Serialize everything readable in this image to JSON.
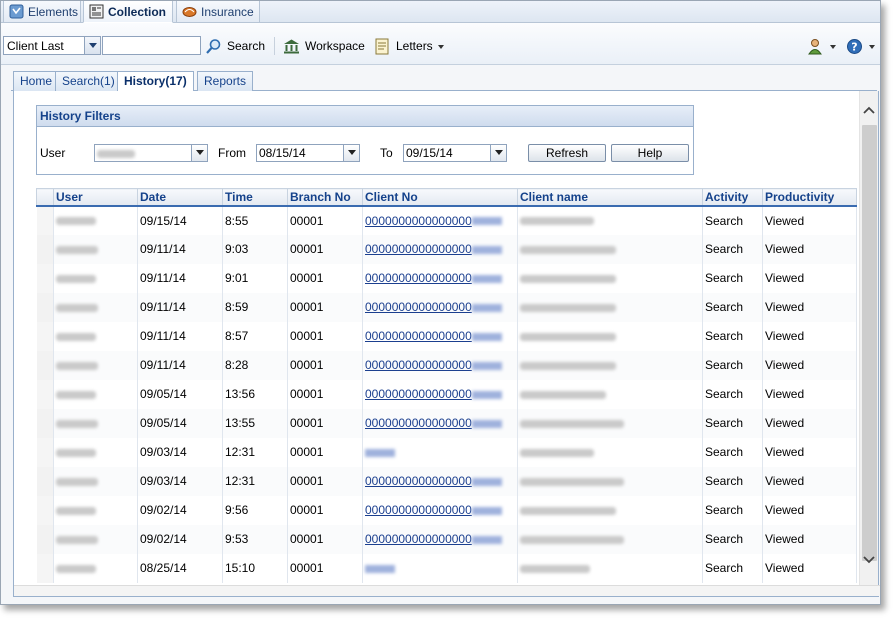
{
  "app_tabs": [
    {
      "label": "Elements",
      "icon": "elements-icon"
    },
    {
      "label": "Collection",
      "icon": "collection-icon"
    },
    {
      "label": "Insurance",
      "icon": "insurance-icon"
    }
  ],
  "toolbar": {
    "search_field_value": "Client Last",
    "search_input_value": "",
    "search_label": "Search",
    "workspace_label": "Workspace",
    "letters_label": "Letters"
  },
  "content_tabs": [
    {
      "label": "Home"
    },
    {
      "label": "Search(1)"
    },
    {
      "label": "History(17)"
    },
    {
      "label": "Reports"
    }
  ],
  "filters": {
    "title": "History Filters",
    "user_label": "User",
    "from_label": "From",
    "from_value": "08/15/14",
    "to_label": "To",
    "to_value": "09/15/14",
    "refresh_label": "Refresh",
    "help_label": "Help"
  },
  "grid": {
    "columns": [
      "User",
      "Date",
      "Time",
      "Branch No",
      "Client No",
      "Client name",
      "Activity",
      "Productivity"
    ],
    "rows": [
      {
        "date": "09/15/14",
        "time": "8:55",
        "branch": "00001",
        "client_no": "0000000000000000",
        "activity": "Search",
        "productivity": "Viewed"
      },
      {
        "date": "09/11/14",
        "time": "9:03",
        "branch": "00001",
        "client_no": "0000000000000000",
        "activity": "Search",
        "productivity": "Viewed"
      },
      {
        "date": "09/11/14",
        "time": "9:01",
        "branch": "00001",
        "client_no": "0000000000000000",
        "activity": "Search",
        "productivity": "Viewed"
      },
      {
        "date": "09/11/14",
        "time": "8:59",
        "branch": "00001",
        "client_no": "0000000000000000",
        "activity": "Search",
        "productivity": "Viewed"
      },
      {
        "date": "09/11/14",
        "time": "8:57",
        "branch": "00001",
        "client_no": "0000000000000000",
        "activity": "Search",
        "productivity": "Viewed"
      },
      {
        "date": "09/11/14",
        "time": "8:28",
        "branch": "00001",
        "client_no": "0000000000000000",
        "activity": "Search",
        "productivity": "Viewed"
      },
      {
        "date": "09/05/14",
        "time": "13:56",
        "branch": "00001",
        "client_no": "0000000000000000",
        "activity": "Search",
        "productivity": "Viewed"
      },
      {
        "date": "09/05/14",
        "time": "13:55",
        "branch": "00001",
        "client_no": "0000000000000000",
        "activity": "Search",
        "productivity": "Viewed"
      },
      {
        "date": "09/03/14",
        "time": "12:31",
        "branch": "00001",
        "client_no": "",
        "activity": "Search",
        "productivity": "Viewed"
      },
      {
        "date": "09/03/14",
        "time": "12:31",
        "branch": "00001",
        "client_no": "0000000000000000",
        "activity": "Search",
        "productivity": "Viewed"
      },
      {
        "date": "09/02/14",
        "time": "9:56",
        "branch": "00001",
        "client_no": "0000000000000000",
        "activity": "Search",
        "productivity": "Viewed"
      },
      {
        "date": "09/02/14",
        "time": "9:53",
        "branch": "00001",
        "client_no": "0000000000000000",
        "activity": "Search",
        "productivity": "Viewed"
      },
      {
        "date": "08/25/14",
        "time": "15:10",
        "branch": "00001",
        "client_no": "",
        "activity": "Search",
        "productivity": "Viewed"
      }
    ]
  },
  "colors": {
    "accent": "#15428b",
    "header_rule": "#3a6bb0",
    "link": "#1b3f8f"
  }
}
